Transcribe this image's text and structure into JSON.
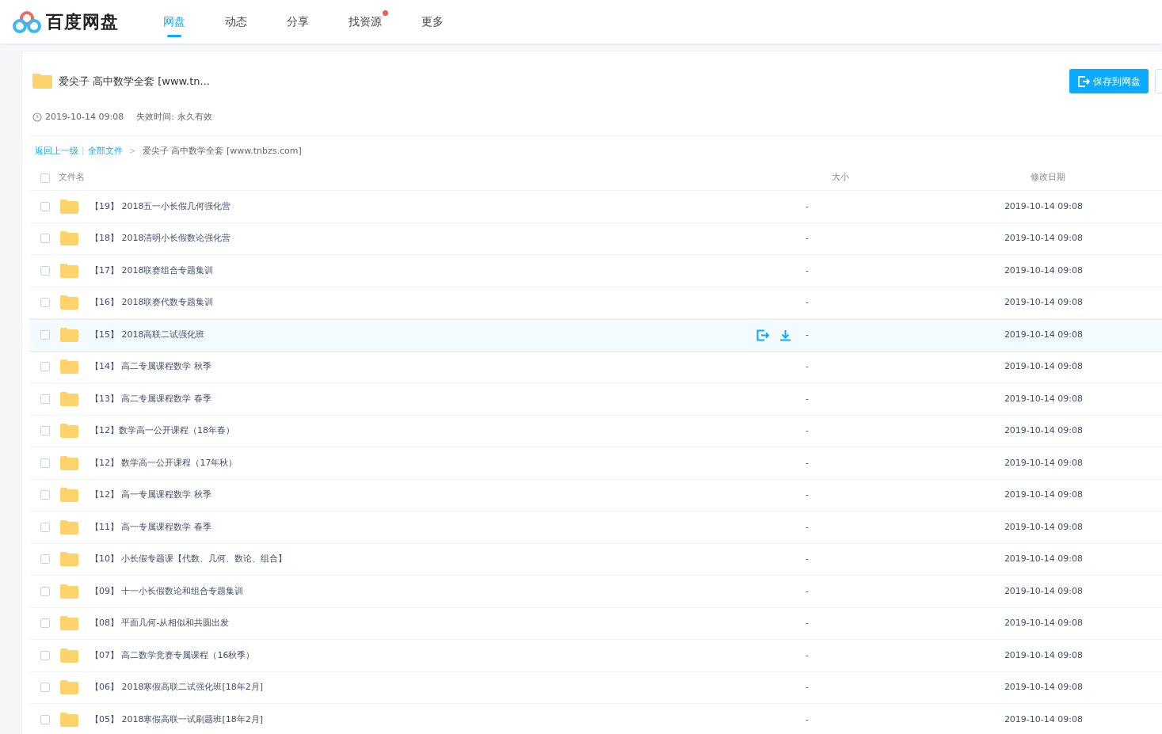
{
  "app": {
    "name": "百度网盘"
  },
  "nav_tabs": [
    {
      "label": "网盘",
      "selected": true,
      "dot": false
    },
    {
      "label": "动态",
      "selected": false,
      "dot": false
    },
    {
      "label": "分享",
      "selected": false,
      "dot": false
    },
    {
      "label": "找资源",
      "selected": false,
      "dot": true
    },
    {
      "label": "更多",
      "selected": false,
      "dot": false
    }
  ],
  "share": {
    "title": "爱尖子 高中数学全套  [www.tn...",
    "date": "2019-10-14 09:08",
    "expiry_label": "失效时间:",
    "expiry": "永久有效",
    "save_button": "保存到网盘"
  },
  "breadcrumb": {
    "back": "返回上一级",
    "divider": "|",
    "root": "全部文件",
    "separator": ">",
    "current": "爱尖子 高中数学全套 [www.tnbzs.com]"
  },
  "table": {
    "columns": [
      "文件名",
      "大小",
      "修改日期"
    ],
    "all_checked": false,
    "rows": [
      {
        "name": "【19】 2018五一小长假几何强化营",
        "size": "-",
        "modified": "2019-10-14 09:08",
        "checked": false,
        "hovered": false
      },
      {
        "name": "【18】 2018清明小长假数论强化营",
        "size": "-",
        "modified": "2019-10-14 09:08",
        "checked": false,
        "hovered": false
      },
      {
        "name": "【17】 2018联赛组合专题集训",
        "size": "-",
        "modified": "2019-10-14 09:08",
        "checked": false,
        "hovered": false
      },
      {
        "name": "【16】 2018联赛代数专题集训",
        "size": "-",
        "modified": "2019-10-14 09:08",
        "checked": false,
        "hovered": false
      },
      {
        "name": "【15】 2018高联二试强化班",
        "size": "-",
        "modified": "2019-10-14 09:08",
        "checked": false,
        "hovered": true
      },
      {
        "name": "【14】 高二专属课程数学 秋季",
        "size": "-",
        "modified": "2019-10-14 09:08",
        "checked": false,
        "hovered": false
      },
      {
        "name": "【13】 高二专属课程数学 春季",
        "size": "-",
        "modified": "2019-10-14 09:08",
        "checked": false,
        "hovered": false
      },
      {
        "name": "【12】数学高一公开课程（18年春）",
        "size": "-",
        "modified": "2019-10-14 09:08",
        "checked": false,
        "hovered": false
      },
      {
        "name": "【12】 数学高一公开课程（17年秋）",
        "size": "-",
        "modified": "2019-10-14 09:08",
        "checked": false,
        "hovered": false
      },
      {
        "name": "【12】 高一专属课程数学 秋季",
        "size": "-",
        "modified": "2019-10-14 09:08",
        "checked": false,
        "hovered": false
      },
      {
        "name": "【11】 高一专属课程数学 春季",
        "size": "-",
        "modified": "2019-10-14 09:08",
        "checked": false,
        "hovered": false
      },
      {
        "name": "【10】 小长假专题课【代数、几何、数论、组合】",
        "size": "-",
        "modified": "2019-10-14 09:08",
        "checked": false,
        "hovered": false
      },
      {
        "name": "【09】 十一小长假数论和组合专题集训",
        "size": "-",
        "modified": "2019-10-14 09:08",
        "checked": false,
        "hovered": false
      },
      {
        "name": "【08】 平面几何-从相似和共圆出发",
        "size": "-",
        "modified": "2019-10-14 09:08",
        "checked": false,
        "hovered": false
      },
      {
        "name": "【07】 高二数学竞赛专属课程（16秋季）",
        "size": "-",
        "modified": "2019-10-14 09:08",
        "checked": false,
        "hovered": false
      },
      {
        "name": "【06】 2018寒假高联二试强化班[18年2月]",
        "size": "-",
        "modified": "2019-10-14 09:08",
        "checked": false,
        "hovered": false
      },
      {
        "name": "【05】 2018寒假高联一试刷题班[18年2月]",
        "size": "-",
        "modified": "2019-10-14 09:08",
        "checked": false,
        "hovered": false
      }
    ]
  }
}
